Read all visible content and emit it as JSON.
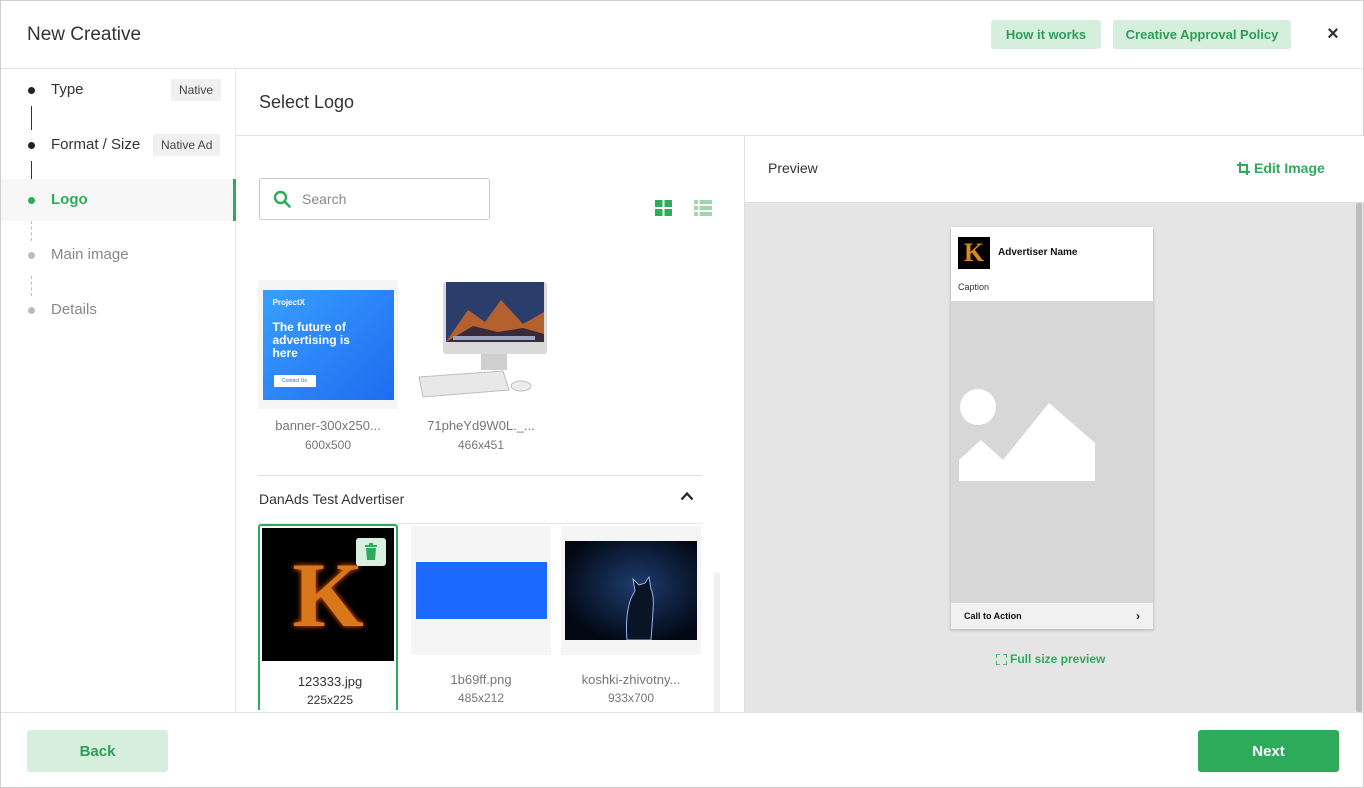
{
  "header": {
    "title": "New Creative",
    "how_it_works": "How it works",
    "approval_policy": "Creative Approval Policy",
    "close": "×"
  },
  "steps": [
    {
      "label": "Type",
      "tag": "Native",
      "state": "done"
    },
    {
      "label": "Format / Size",
      "tag": "Native Ad",
      "state": "done"
    },
    {
      "label": "Logo",
      "tag": "",
      "state": "active"
    },
    {
      "label": "Main image",
      "tag": "",
      "state": "todo"
    },
    {
      "label": "Details",
      "tag": "",
      "state": "todo"
    }
  ],
  "section": {
    "title": "Select Logo"
  },
  "search": {
    "placeholder": "Search",
    "value": ""
  },
  "images": [
    {
      "name": "banner-300x250...",
      "dim": "600x500",
      "thumb_text": {
        "brand": "ProjectX",
        "headline": "The future of advertising is here",
        "cta": "Contact Us"
      }
    },
    {
      "name": "71pheYd9W0L._...",
      "dim": "466x451"
    }
  ],
  "advertiser_group": {
    "name": "DanAds Test Advertiser",
    "images": [
      {
        "name": "123333.jpg",
        "dim": "225x225",
        "selected": true,
        "glyph": "K"
      },
      {
        "name": "1b69ff.png",
        "dim": "485x212",
        "color": "#1b69ff"
      },
      {
        "name": "koshki-zhivotny...",
        "dim": "933x700"
      }
    ]
  },
  "preview": {
    "title": "Preview",
    "edit_image": "Edit Image",
    "ad": {
      "logo_glyph": "K",
      "advertiser_name": "Advertiser Name",
      "caption": "Caption",
      "cta": "Call to Action",
      "cta_arrow": "›"
    },
    "full_size": "Full size preview"
  },
  "footer": {
    "back": "Back",
    "next": "Next"
  },
  "colors": {
    "accent": "#2eab5a",
    "accent_light": "#d5efdc",
    "blue_image": "#1b69ff"
  }
}
